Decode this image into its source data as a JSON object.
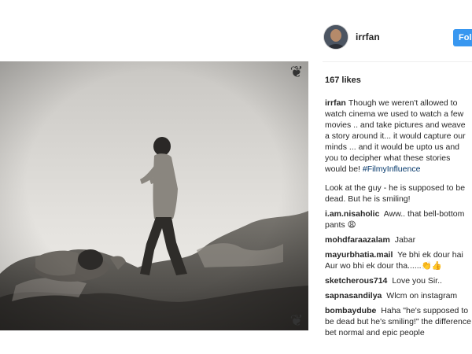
{
  "post": {
    "username": "irrfan",
    "follow_label": "Foll",
    "likes": "167 likes",
    "caption_user": "irrfan",
    "caption_text": "Though we weren't allowed to watch cinema we used to watch a few movies .. and take pictures and weave a story around it... it would capture our minds ... and it would be upto us and you to decipher what these stories would be!",
    "caption_hashtag": "#FilmyInfluence"
  },
  "comments": [
    {
      "user": "",
      "text": "Look at the guy - he is supposed to be dead. But he is smiling!"
    },
    {
      "user": "i.am.nisaholic",
      "text": "Aww.. that bell-bottom pants 😩"
    },
    {
      "user": "mohdfaraazalam",
      "text": "Jabar"
    },
    {
      "user": "mayurbhatia.mail",
      "text": "Ye bhi ek dour hai Aur wo bhi ek dour tha......👏👍"
    },
    {
      "user": "sketcherous714",
      "text": "Love you Sir.."
    },
    {
      "user": "sapnasandilya",
      "text": "Wlcm on instagram"
    },
    {
      "user": "bombaydube",
      "text": "Haha \"he's supposed to be dead but he's smiling!\" the difference bet normal and epic people"
    }
  ],
  "icons": {
    "corner_top": "ornament-corner-icon",
    "corner_bottom": "ornament-corner-icon"
  },
  "colors": {
    "follow_button": "#3897f0",
    "hashtag": "#003569"
  }
}
